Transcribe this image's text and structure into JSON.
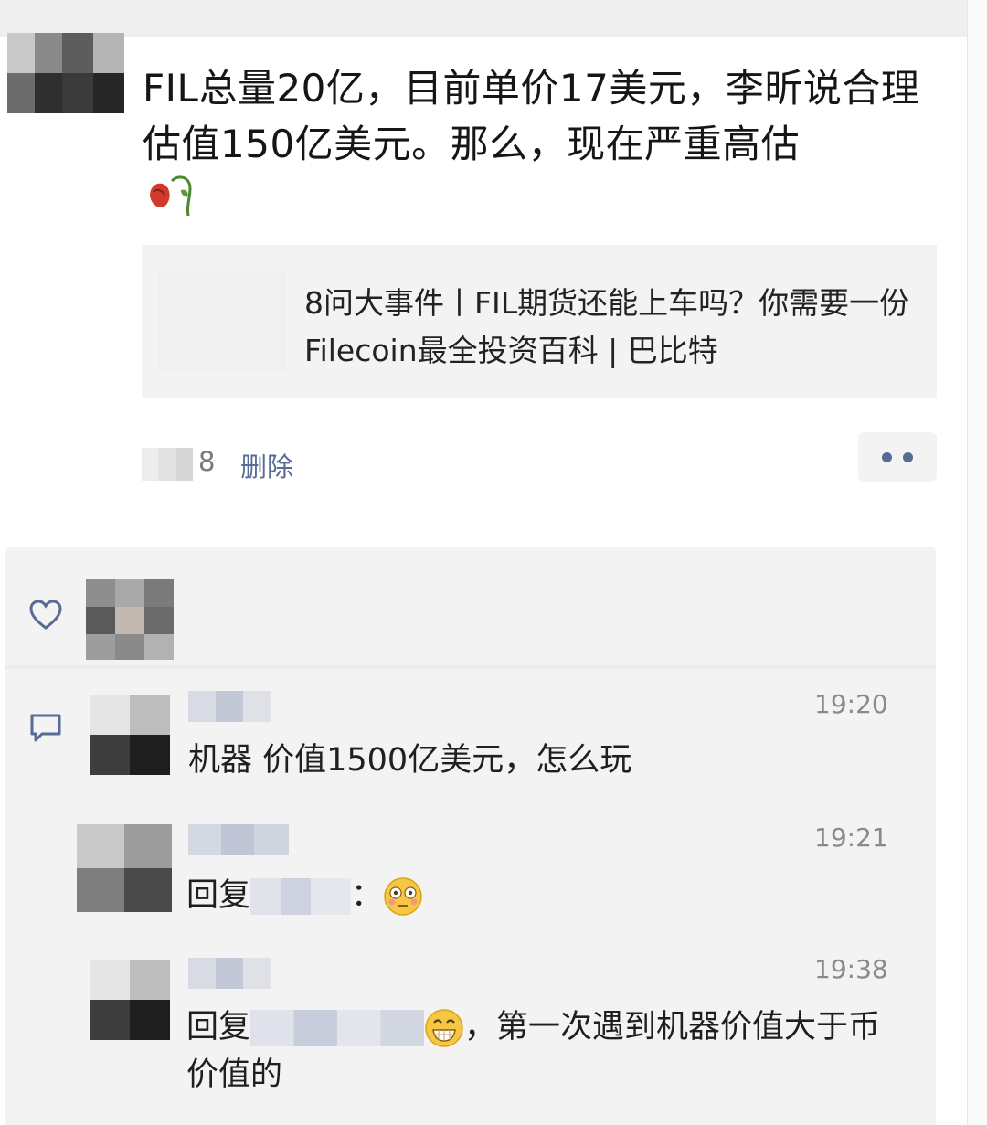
{
  "post": {
    "text": "FIL总量20亿，目前单价17美元，李昕说合理估值150亿美元。那么，现在严重高估",
    "emoji_icon": "wilted-rose-emoji",
    "link_card": {
      "title": "8问大事件丨FIL期货还能上车吗？你需要一份Filecoin最全投资百科 | 巴比特"
    },
    "meta": {
      "number": "8",
      "delete_label": "删除",
      "more_icon": "more-dots-icon"
    }
  },
  "likes": {
    "icon": "heart-icon"
  },
  "comments": {
    "icon": "comment-icon",
    "items": [
      {
        "time": "19:20",
        "body": "机器 价值1500亿美元，怎么玩"
      },
      {
        "time": "19:21",
        "reply_label": "回复",
        "colon": "：",
        "emoji": "flushed-face-emoji"
      },
      {
        "time": "19:38",
        "reply_label": "回复",
        "text": "，第一次遇到机器价值大于币价值的",
        "emoji": "grinning-face-emoji"
      }
    ]
  },
  "colors": {
    "link_blue": "#576b95",
    "panel_bg": "#f3f3f3",
    "time_gray": "#8a8a8a"
  }
}
